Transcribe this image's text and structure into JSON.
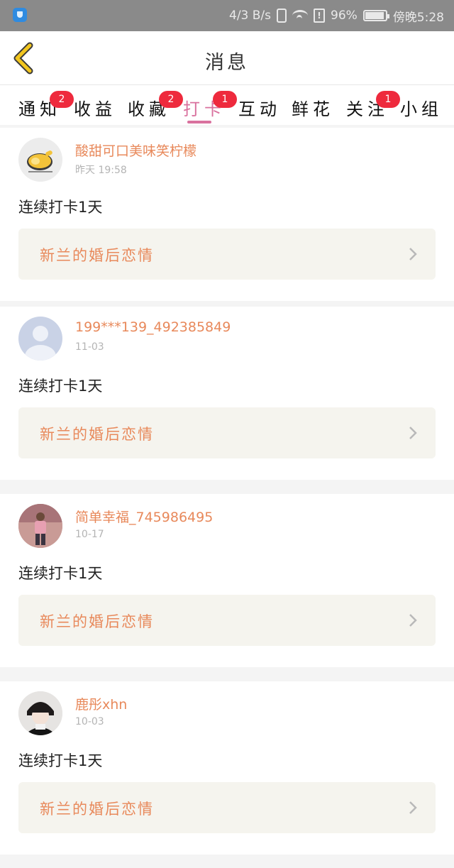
{
  "status_bar": {
    "speed": "4/3 B/s",
    "battery": "96%",
    "time": "傍晚5:28",
    "icons": [
      "shield-app-icon",
      "vibrate-icon",
      "wifi-icon",
      "sim-alert-icon",
      "battery-charging-icon"
    ]
  },
  "header": {
    "title": "消息",
    "back_icon": "chevron-left-icon"
  },
  "tabs": [
    {
      "label": "通知",
      "badge": "2"
    },
    {
      "label": "收益",
      "badge": ""
    },
    {
      "label": "收藏",
      "badge": "2"
    },
    {
      "label": "打卡",
      "badge": "1",
      "active": true
    },
    {
      "label": "互动",
      "badge": ""
    },
    {
      "label": "鲜花",
      "badge": ""
    },
    {
      "label": "关注",
      "badge": "1"
    },
    {
      "label": "小组",
      "badge": ""
    }
  ],
  "messages": [
    {
      "username": "酸甜可口美味笑柠檬",
      "time": "昨天 19:58",
      "content": "连续打卡1天",
      "book": "新兰的婚后恋情",
      "avatar": "lemon-avatar"
    },
    {
      "username": "199***139_492385849",
      "time": "11-03",
      "content": "连续打卡1天",
      "book": "新兰的婚后恋情",
      "avatar": "default-person-avatar"
    },
    {
      "username": "简单幸福_745986495",
      "time": "10-17",
      "content": "连续打卡1天",
      "book": "新兰的婚后恋情",
      "avatar": "photo-avatar"
    },
    {
      "username": "鹿彤xhn",
      "time": "10-03",
      "content": "连续打卡1天",
      "book": "新兰的婚后恋情",
      "avatar": "anime-avatar"
    }
  ],
  "colors": {
    "accent_pink": "#d9719e",
    "name_orange": "#e8895b",
    "badge_red": "#ee2a3d",
    "status_bar": "#8a8a8a",
    "back_yellow": "#f2c61f"
  }
}
